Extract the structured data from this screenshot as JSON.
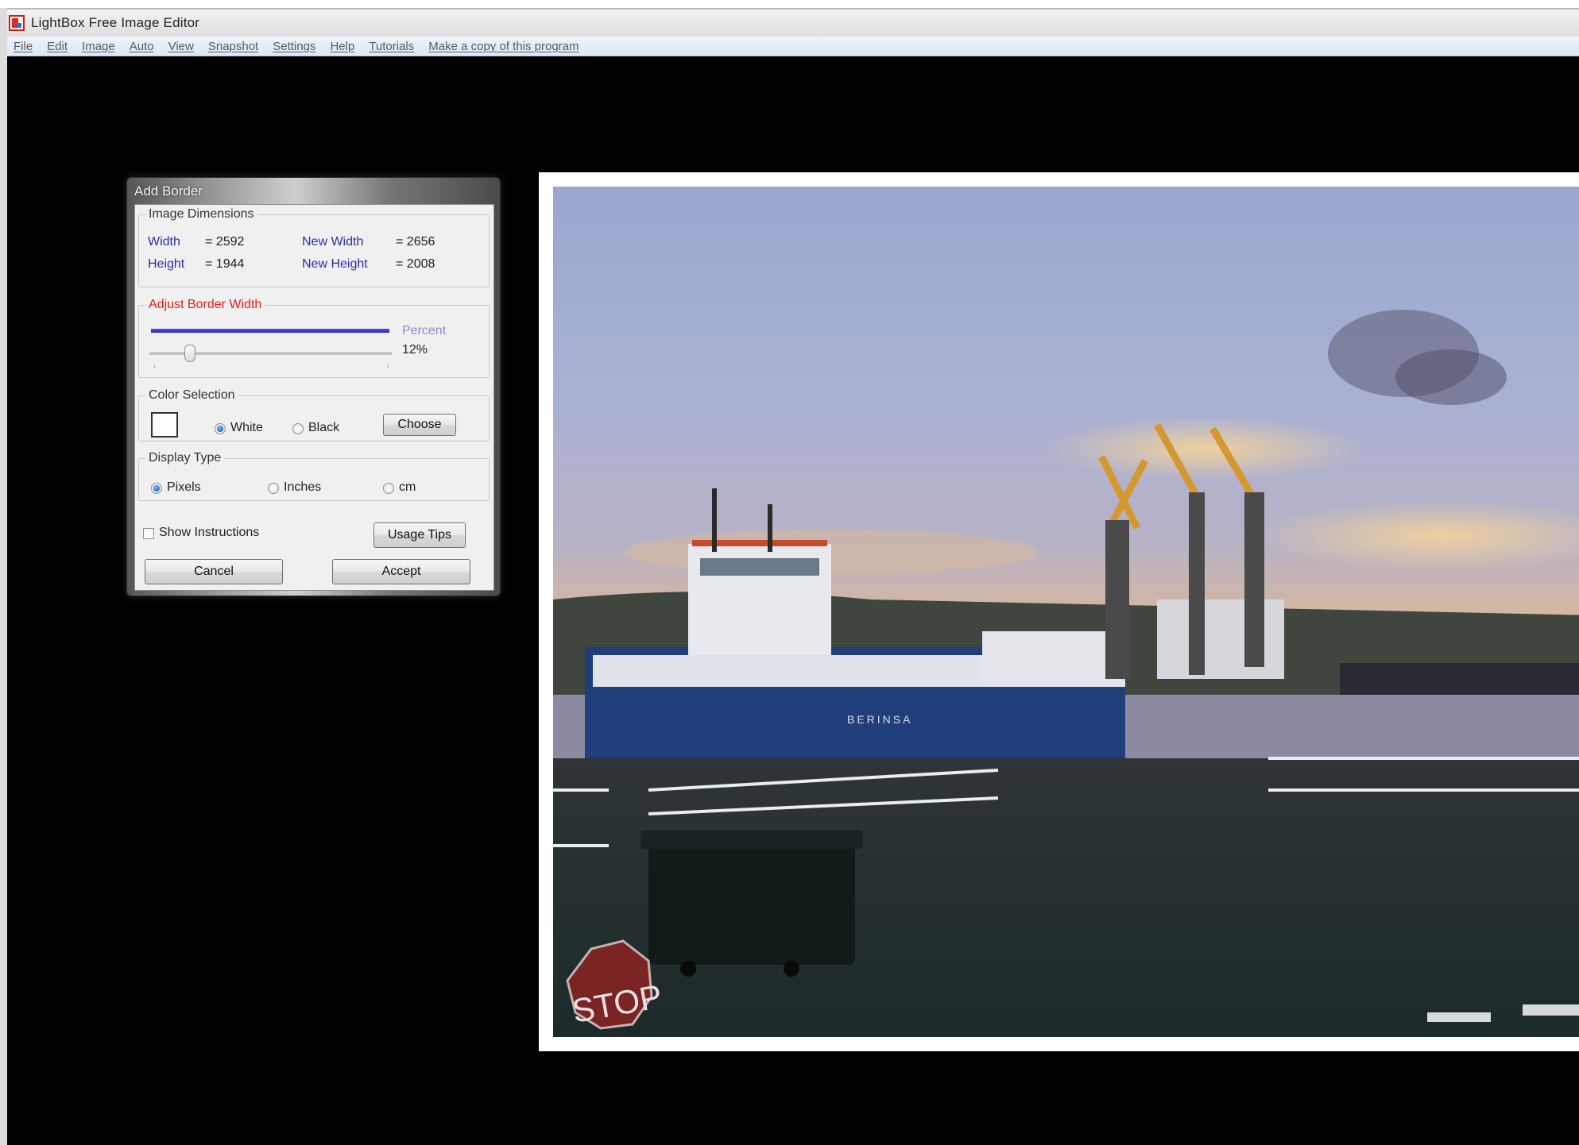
{
  "window": {
    "title": "LightBox Free Image Editor"
  },
  "menu": {
    "items": [
      {
        "label": "File"
      },
      {
        "label": "Edit"
      },
      {
        "label": "Image"
      },
      {
        "label": "Auto"
      },
      {
        "label": "View"
      },
      {
        "label": "Snapshot"
      },
      {
        "label": "Settings"
      },
      {
        "label": "Help"
      },
      {
        "label": "Tutorials"
      },
      {
        "label": "Make a copy of this program"
      }
    ]
  },
  "dialog": {
    "title": "Add Border",
    "dimensions": {
      "legend": "Image Dimensions",
      "width_label": "Width",
      "width_value": "= 2592",
      "height_label": "Height",
      "height_value": "= 1944",
      "new_width_label": "New Width",
      "new_width_value": "= 2656",
      "new_height_label": "New Height",
      "new_height_value": "= 2008"
    },
    "border_width": {
      "legend": "Adjust Border Width",
      "unit_label": "Percent",
      "value_text": "12%",
      "slider_fraction": 0.12
    },
    "color_selection": {
      "legend": "Color Selection",
      "swatch_color": "#ffffff",
      "options": [
        {
          "label": "White",
          "checked": true
        },
        {
          "label": "Black",
          "checked": false
        }
      ],
      "choose_label": "Choose"
    },
    "display_type": {
      "legend": "Display Type",
      "options": [
        {
          "label": "Pixels",
          "checked": true
        },
        {
          "label": "Inches",
          "checked": false
        },
        {
          "label": "cm",
          "checked": false
        }
      ]
    },
    "show_instructions": {
      "label": "Show Instructions",
      "checked": false
    },
    "usage_tips_label": "Usage Tips",
    "cancel_label": "Cancel",
    "accept_label": "Accept"
  },
  "photo": {
    "border_color": "#ffffff",
    "ship_name": "BERINSA",
    "sign_text": "STOP"
  },
  "colors": {
    "canvas_background": "#000000",
    "accent_blue": "#2c2ea8",
    "accent_red": "#e0201c"
  }
}
